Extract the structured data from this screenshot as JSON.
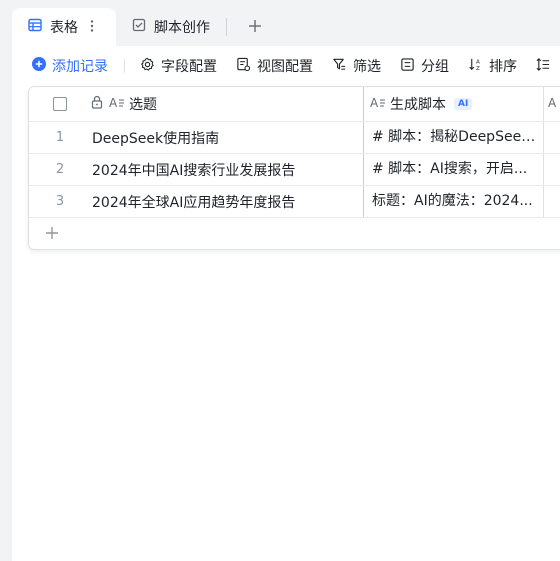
{
  "tabs": [
    {
      "label": "表格",
      "icon": "table-icon",
      "active": true
    },
    {
      "label": "脚本创作",
      "icon": "form-icon",
      "active": false
    }
  ],
  "toolbar": {
    "add_record": "添加记录",
    "field_config": "字段配置",
    "view_config": "视图配置",
    "filter": "筛选",
    "group": "分组",
    "sort": "排序"
  },
  "table": {
    "columns": [
      {
        "label": "选题",
        "icon": "text-field-icon",
        "locked": true
      },
      {
        "label": "生成脚本",
        "icon": "text-field-icon",
        "badge": "AI"
      }
    ],
    "rows": [
      {
        "num": "1",
        "title": "DeepSeek使用指南",
        "script": "# 脚本：揭秘DeepSeek-..."
      },
      {
        "num": "2",
        "title": "2024年中国AI搜索行业发展报告",
        "script": "# 脚本：AI搜索，开启..."
      },
      {
        "num": "3",
        "title": "2024年全球AI应用趋势年度报告",
        "script": "标题：AI的魔法：2024..."
      }
    ]
  },
  "colors": {
    "accent": "#3370ff",
    "tab_bar_bg": "#f2f3f5",
    "border": "#dee0e3"
  }
}
